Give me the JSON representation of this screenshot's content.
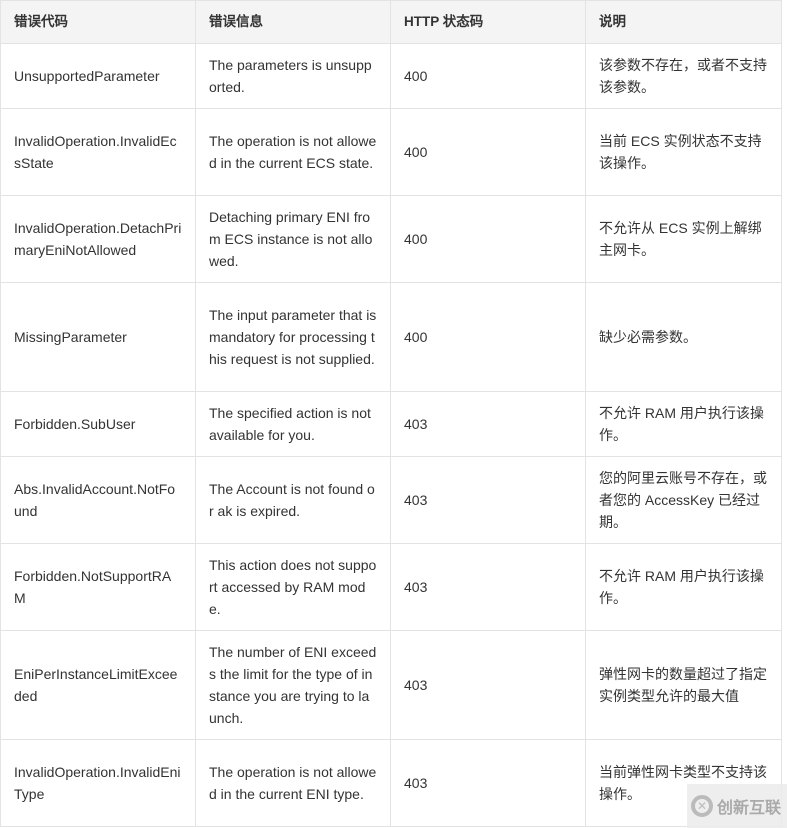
{
  "headers": [
    "错误代码",
    "错误信息",
    "HTTP 状态码",
    "说明"
  ],
  "rows": [
    {
      "code": "UnsupportedParameter",
      "message": "The parameters is unsupported.",
      "status": "400",
      "desc": "该参数不存在，或者不支持该参数。"
    },
    {
      "code": "InvalidOperation.InvalidEcsState",
      "message": "The operation is not allowed in the current ECS state.",
      "status": "400",
      "desc": "当前 ECS 实例状态不支持该操作。"
    },
    {
      "code": "InvalidOperation.DetachPrimaryEniNotAllowed",
      "message": "Detaching primary ENI from ECS instance is not allowed.",
      "status": "400",
      "desc": "不允许从 ECS 实例上解绑主网卡。"
    },
    {
      "code": "MissingParameter",
      "message": "The input parameter that is mandatory for processing this request is not supplied.",
      "status": "400",
      "desc": "缺少必需参数。"
    },
    {
      "code": "Forbidden.SubUser",
      "message": "The specified action is not available for you.",
      "status": "403",
      "desc": "不允许 RAM 用户执行该操作。"
    },
    {
      "code": "Abs.InvalidAccount.NotFound",
      "message": "The Account is not found or ak is expired.",
      "status": "403",
      "desc": "您的阿里云账号不存在，或者您的 AccessKey 已经过期。"
    },
    {
      "code": "Forbidden.NotSupportRAM",
      "message": "This action does not support accessed by RAM mode.",
      "status": "403",
      "desc": "不允许 RAM 用户执行该操作。"
    },
    {
      "code": "EniPerInstanceLimitExceeded",
      "message": "The number of ENI exceeds the limit for the type of instance you are trying to launch.",
      "status": "403",
      "desc": "弹性网卡的数量超过了指定实例类型允许的最大值"
    },
    {
      "code": "InvalidOperation.InvalidEniType",
      "message": "The operation is not allowed in the current ENI type.",
      "status": "403",
      "desc": "当前弹性网卡类型不支持该操作。"
    }
  ],
  "watermark": "创新互联"
}
